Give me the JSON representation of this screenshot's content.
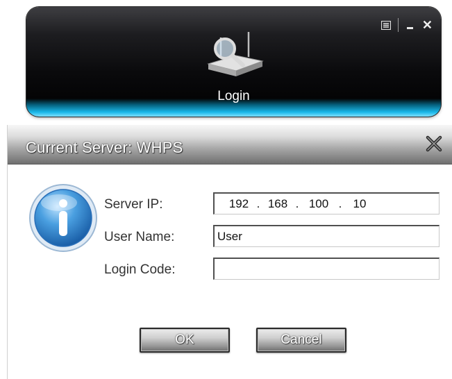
{
  "launcher": {
    "label": "Login",
    "icon": "router-search-icon",
    "controls": [
      "menu-icon",
      "minimize-icon",
      "close-icon"
    ]
  },
  "dialog": {
    "title": "Current Server: WHPS",
    "icon": "info-icon",
    "fields": {
      "server_ip": {
        "label": "Server IP:",
        "octets": [
          "192",
          "168",
          "100",
          "10"
        ],
        "separator": "."
      },
      "user_name": {
        "label": "User Name:",
        "value": "User"
      },
      "login_code": {
        "label": "Login Code:",
        "value": ""
      }
    },
    "buttons": {
      "ok": "OK",
      "cancel": "Cancel"
    }
  },
  "colors": {
    "accent_glow": "#19b7e8",
    "info_blue": "#2a7fd0"
  }
}
